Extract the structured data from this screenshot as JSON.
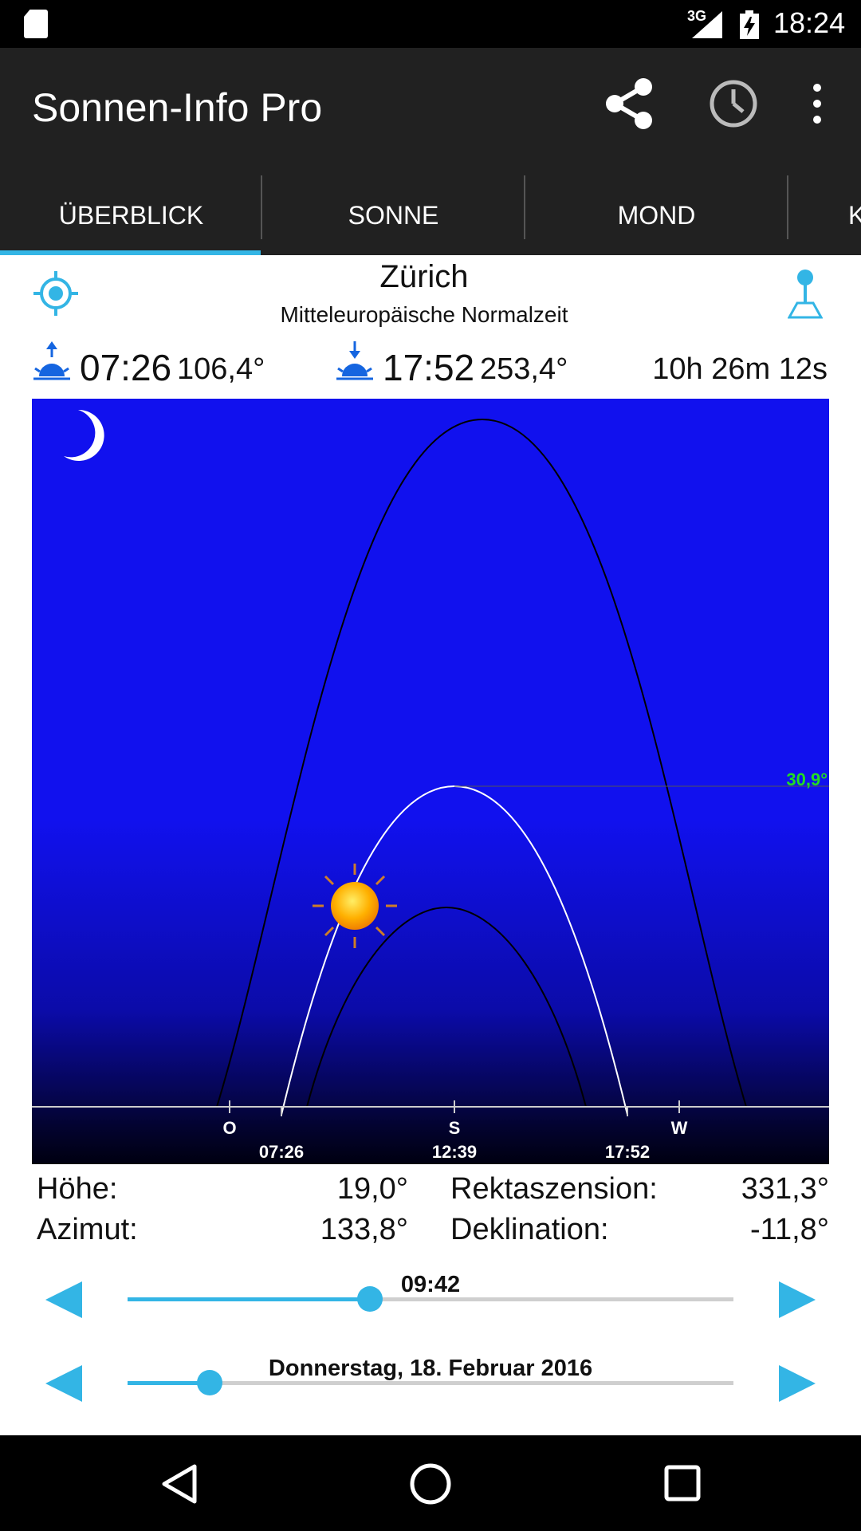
{
  "status_bar": {
    "network": "3G",
    "time": "18:24"
  },
  "toolbar": {
    "title": "Sonnen-Info Pro",
    "actions": [
      "share-icon",
      "history-icon",
      "more-vert-icon"
    ]
  },
  "tabs": [
    {
      "label": "ÜBERBLICK",
      "selected": true
    },
    {
      "label": "SONNE",
      "selected": false
    },
    {
      "label": "MOND",
      "selected": false
    },
    {
      "label": "K",
      "selected": false
    }
  ],
  "location": {
    "city": "Zürich",
    "timezone": "Mitteleuropäische Normalzeit"
  },
  "sun_times": {
    "sunrise_time": "07:26",
    "sunrise_azimuth": "106,4°",
    "sunset_time": "17:52",
    "sunset_azimuth": "253,4°",
    "day_length": "10h 26m 12s"
  },
  "sky_chart": {
    "max_altitude_label": "30,9°",
    "horizon_labels": {
      "east": "O",
      "south": "S",
      "west": "W"
    },
    "time_labels": {
      "sunrise": "07:26",
      "noon": "12:39",
      "sunset": "17:52"
    },
    "colors": {
      "sky_top": "#1111ee",
      "sky_bottom": "#000010",
      "altitude_label": "#22dd22"
    }
  },
  "values": {
    "altitude_label": "Höhe:",
    "altitude_value": "19,0°",
    "azimuth_label": "Azimut:",
    "azimuth_value": "133,8°",
    "ra_label": "Rektaszension:",
    "ra_value": "331,3°",
    "decl_label": "Deklination:",
    "decl_value": "-11,8°"
  },
  "time_slider": {
    "label": "09:42",
    "fraction": 0.4
  },
  "date_slider": {
    "label": "Donnerstag, 18. Februar 2016",
    "fraction": 0.135
  },
  "accent_color": "#33b5e5"
}
